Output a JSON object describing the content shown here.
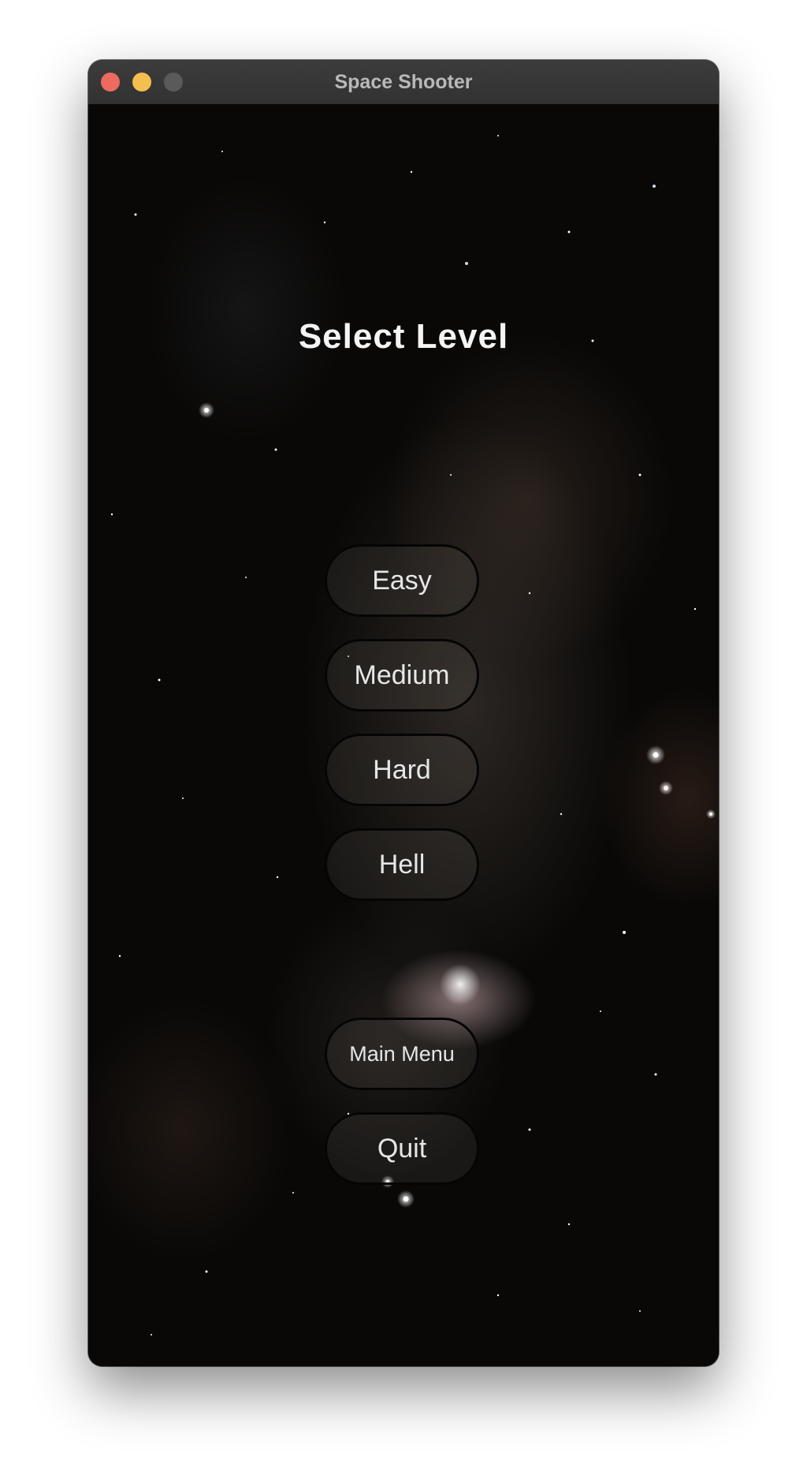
{
  "window": {
    "title": "Space Shooter"
  },
  "screen": {
    "heading": "Select Level",
    "levels": [
      {
        "label": "Easy"
      },
      {
        "label": "Medium"
      },
      {
        "label": "Hard"
      },
      {
        "label": "Hell"
      }
    ],
    "main_menu_label": "Main Menu",
    "quit_label": "Quit"
  },
  "colors": {
    "close": "#ed6a5e",
    "minimize": "#f4bf4f",
    "maximize": "#5a5a5a",
    "titlebar": "#363636",
    "background": "#090807",
    "text": "#e6e6e6"
  }
}
